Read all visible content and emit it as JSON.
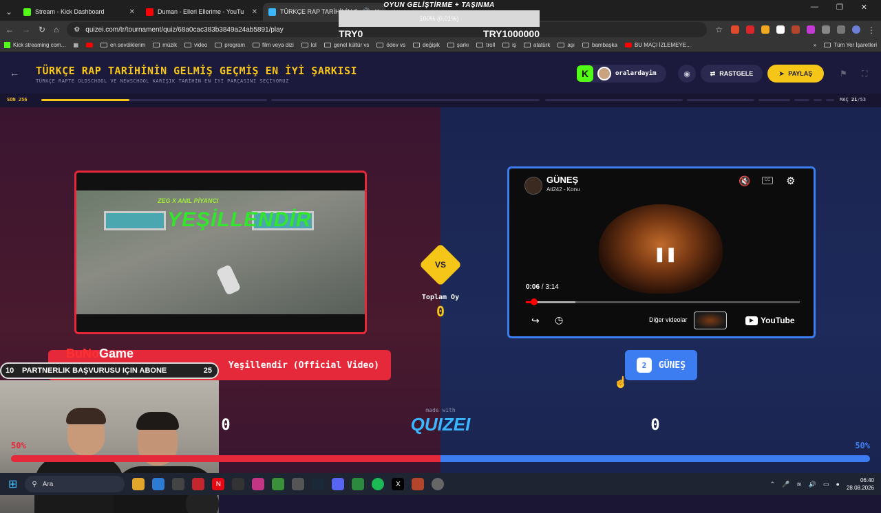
{
  "browser": {
    "tabs": [
      {
        "title": "Stream - Kick Dashboard",
        "color": "#53fc18",
        "active": false
      },
      {
        "title": "Duman - Elleri Ellerime - YouTu",
        "color": "#ff0000",
        "active": false
      },
      {
        "title": "TÜRKÇE RAP TARİHİNİN GE",
        "color": "#3ab7ff",
        "active": true
      }
    ],
    "url": "quizei.com/tr/tournament/quiz/68a0cac383b3849a24ab5891/play",
    "bookmarks": [
      "Kick streaming com...",
      "en sevdiklerim",
      "müzik",
      "video",
      "program",
      "film veya dizi",
      "lol",
      "genel kültür vs",
      "ödev vs",
      "değişik",
      "şarkı",
      "troll",
      "iş",
      "atatürk",
      "aşı",
      "bambaşka",
      "BU MAÇI İZLEMEYE..."
    ],
    "all_bookmarks": "Tüm Yer İşaretleri"
  },
  "overlay": {
    "title": "OYUN GELİŞTİRME + TAŞINMA",
    "progress_text": "100% (0.01%)",
    "min": "TRY0",
    "max": "TRY1000000"
  },
  "header": {
    "title": "TÜRKÇE RAP TARİHİNİN GELMİŞ GEÇMİŞ EN İYİ ŞARKISI",
    "subtitle": "TÜRKÇE RAPTE OLDSCHOOL VE NEWSCHOOL KARIŞIK TARİHİN EN İYİ PARÇASINI SEÇİYORUZ",
    "username": "oralardayim",
    "random_label": "RASTGELE",
    "share_label": "PAYLAŞ"
  },
  "progress": {
    "round_label": "SON 256",
    "match_prefix": "MAÇ",
    "match_current": "21",
    "match_total": "/53",
    "fraction": 0.39
  },
  "left": {
    "video_credit": "ZEG X ANIL PİYANCI",
    "video_big_text": "YEŞİLLENDİR",
    "label": "Yeşillendir (Official Video)",
    "votes": "0",
    "percent": "50%",
    "share": 0.5
  },
  "stream_overlay": {
    "brand_red": "BuNo",
    "brand_white": "Game",
    "partner_left": "10",
    "partner_text": "PARTNERLIK BAŞVURUSU IÇIN ABONE",
    "partner_right": "25"
  },
  "center": {
    "vs": "VS",
    "total_label": "Toplam Oy",
    "total_value": "0",
    "made_with": "made with",
    "brand": "QUIZEI"
  },
  "right": {
    "yt_title": "GÜNEŞ",
    "yt_channel": "Ati242 - Konu",
    "time_current": "0:06",
    "time_total": "/ 3:14",
    "progress_fraction": 0.031,
    "buffer_fraction": 0.18,
    "more_videos": "Diğer videolar",
    "yt_brand": "YouTube",
    "number": "2",
    "label": "GÜNEŞ",
    "votes": "0",
    "percent": "50%"
  },
  "taskbar": {
    "search": "Ara",
    "time": "06:40",
    "date": "28.08.2026"
  }
}
